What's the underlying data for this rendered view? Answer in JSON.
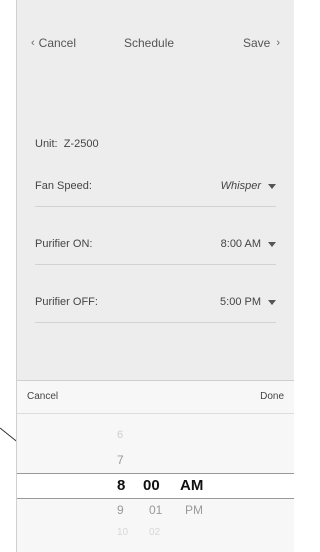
{
  "header": {
    "cancel_label": "Cancel",
    "title": "Schedule",
    "save_label": "Save"
  },
  "settings": {
    "unit_label": "Unit:",
    "unit_value": "Z-2500",
    "fan_speed_label": "Fan Speed:",
    "fan_speed_value": "Whisper",
    "purifier_on_label": "Purifier ON:",
    "purifier_on_value": "8:00 AM",
    "purifier_off_label": "Purifier OFF:",
    "purifier_off_value": "5:00 PM"
  },
  "picker": {
    "cancel_label": "Cancel",
    "done_label": "Done",
    "rows": [
      {
        "hour": "6",
        "minute": "",
        "period": ""
      },
      {
        "hour": "7",
        "minute": "",
        "period": ""
      },
      {
        "hour": "8",
        "minute": "00",
        "period": "AM"
      },
      {
        "hour": "9",
        "minute": "01",
        "period": "PM"
      },
      {
        "hour": "10",
        "minute": "02",
        "period": ""
      }
    ]
  }
}
